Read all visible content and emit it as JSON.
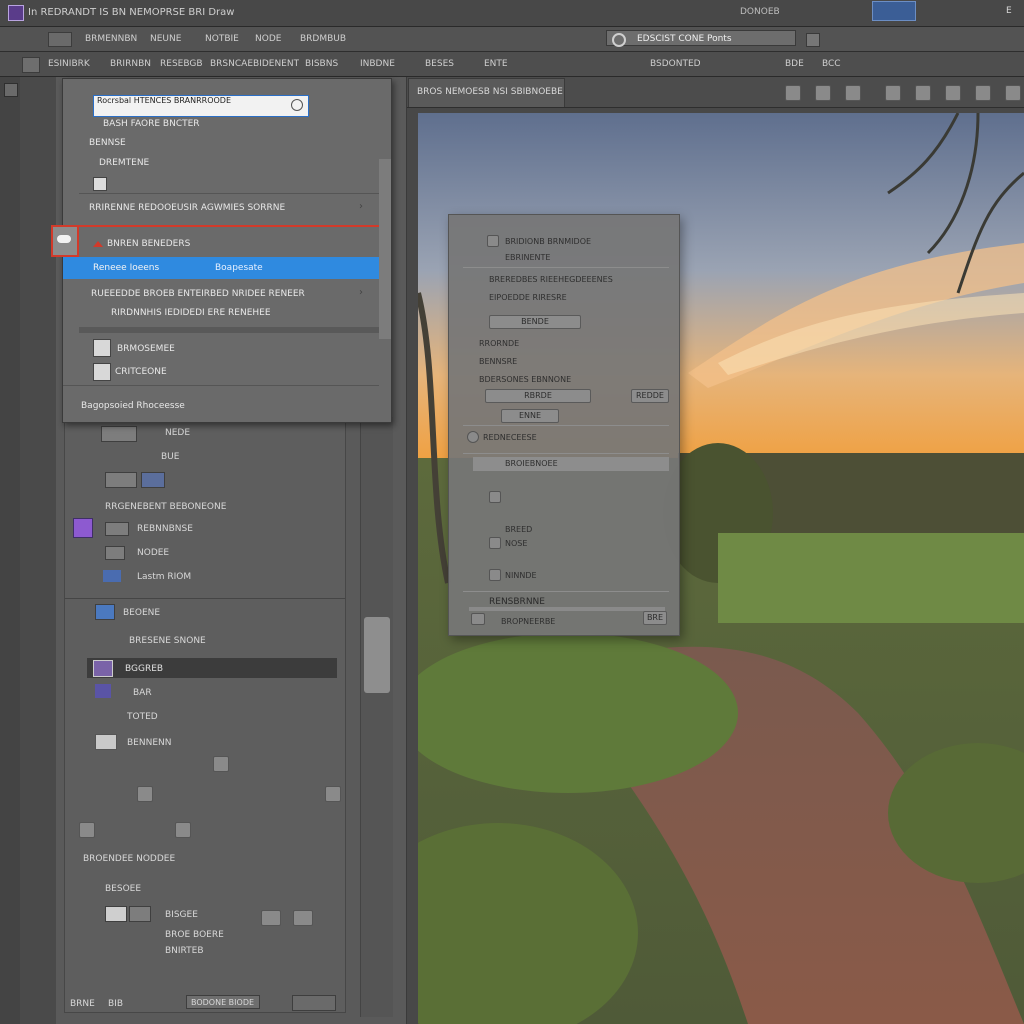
{
  "titlebar": {
    "title": "In REDRANDT IS BN NEMOPRSE BRI Draw",
    "center": "DONOEB",
    "right": "E"
  },
  "menubar": {
    "items": [
      "BRMENNBN",
      "NEUNE",
      "NOTBIE",
      "NODE",
      "BRDMBUB"
    ],
    "center_field": "EDSCIST CONE Ponts"
  },
  "options": {
    "items": [
      "ESINIBRK",
      "BRIRNBN",
      "RESEBGB",
      "BRSNCAEBIDENENT",
      "BISBNS",
      "INBDNE",
      "BESES",
      "ENTE",
      "BSDONTED",
      "BDE",
      "BCC"
    ]
  },
  "dropdown": {
    "search_value": "Rocrsbal HTENCES BRANRROODE",
    "items": [
      "BASH FAORE BNCTER",
      "BENNSE",
      "DREMTENE",
      "RRIRENNE REDOOEUSIR AGWMIES SORRNE",
      "BNREN BENEDERS",
      "Reneee Ioeens",
      "Boapesate",
      "RUEEEDDE BROEB ENTEIRBED NRIDEE RENEER",
      "RIRDNNHIS IEDIDEDI ERE RENEHEE",
      "BRMOSEMEE",
      "CRITCEONE",
      "Bagopsoied Rhoceesse"
    ],
    "highlight_color": "#2f8ae0",
    "accent_color": "#d23a2a"
  },
  "layers": {
    "rows": [
      "NEDE",
      "BUE",
      "RRGENEBENT BEBONEONE",
      "REBNNBNSE",
      "NODEE",
      "Lastm RIOM",
      "BEOENE",
      "BRESENE SNONE",
      "BGGREB",
      "BAR",
      "TOTED",
      "BENNENN",
      "BROENDEE NODDEE",
      "BESOEE",
      "BISGEE",
      "BROE BOERE",
      "BNIRTEB"
    ],
    "footer": [
      "BRNE",
      "BIB",
      "BODONE BIODE"
    ]
  },
  "canvas": {
    "doc_tab": "BROS NEMOESB NSI SBIBNOEBE"
  },
  "dialog": {
    "rows": [
      "BRIDIONB BRNMIDOE",
      "EBRINENTE",
      "BREREDBES RIEEHEGDEEENES",
      "EIPOEDDE RIRESRE",
      "RRORNDE",
      "BENNSRE",
      "BDERSONES EBNNONE",
      "REDNECEESE",
      "BROIEBNOEE",
      "BREED",
      "NOSE",
      "NINNDE"
    ],
    "buttons": [
      "BENDE",
      "RBRDE",
      "REDDE",
      "ENNE"
    ],
    "footer_title": "RENSBRNNE",
    "footer_sub": "BROPNEERBE",
    "footer_btn": "BRE"
  },
  "colors": {
    "sky_top": "#5f6f8e",
    "sunset": "#f0a040",
    "path": "#8a5a48",
    "grass": "#6f8a45"
  }
}
